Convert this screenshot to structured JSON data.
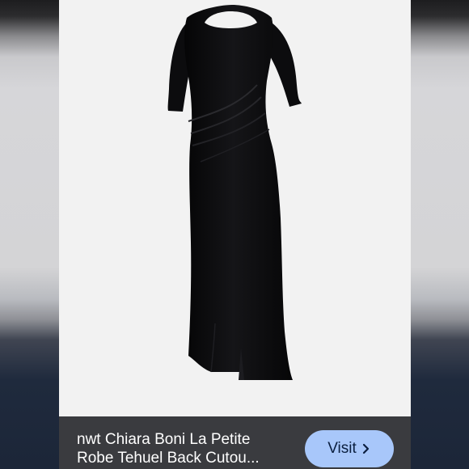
{
  "listing": {
    "title_line_1": "nwt Chiara Boni La Petite",
    "title_line_2": "Robe Tehuel Back Cutou...",
    "visit_label": "Visit"
  },
  "icons": {
    "visit_button_icon": "chevron-right-icon"
  },
  "colors": {
    "panel_background": "#f2f2f2",
    "dress": "#0d0d0f",
    "info_bar": "#3a3b3f",
    "visit_button": "#a8c7fa",
    "visit_button_text": "#0b1f3f",
    "title_text": "#ffffff"
  }
}
